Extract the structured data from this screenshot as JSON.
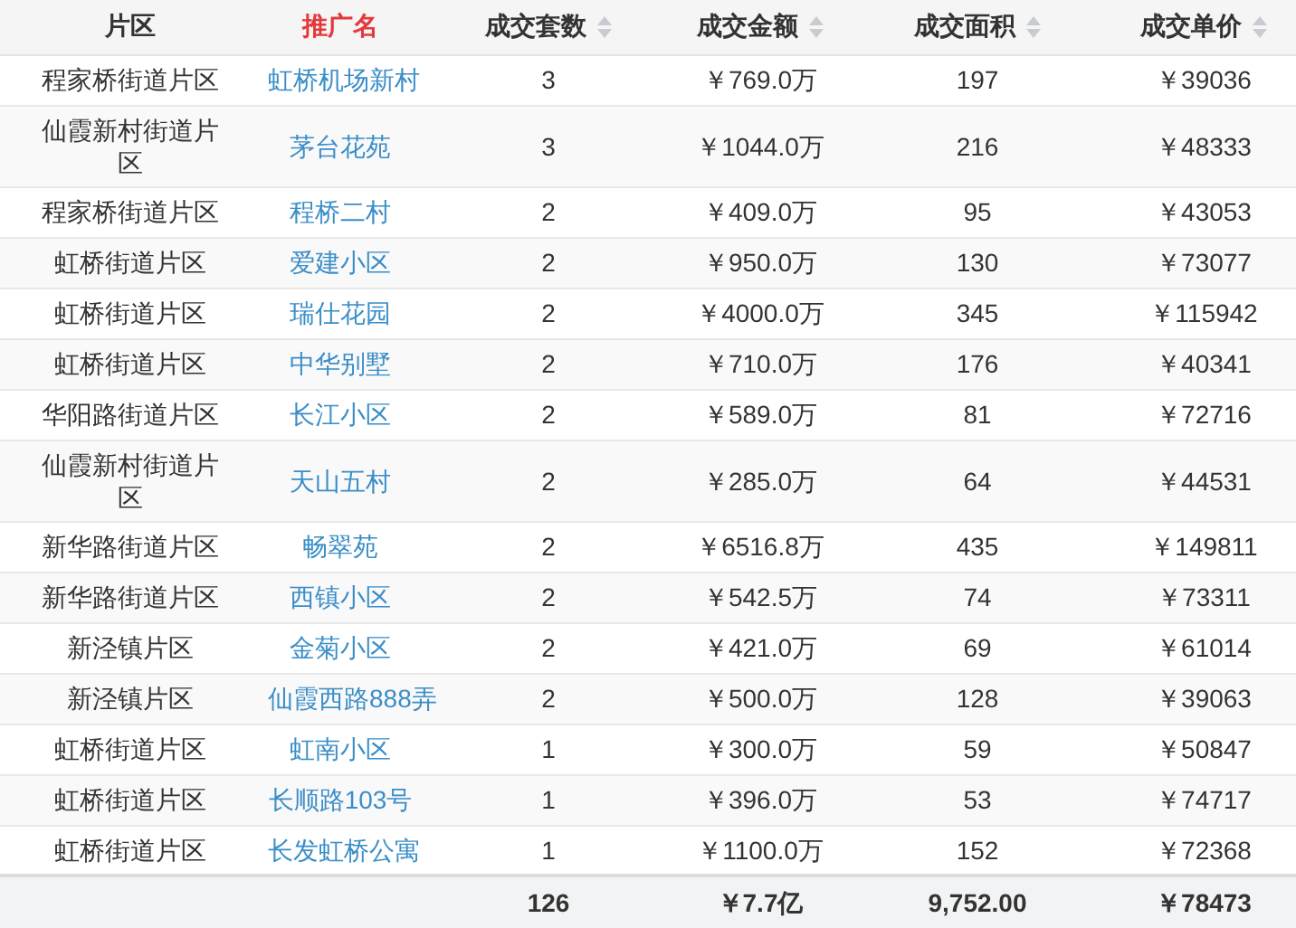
{
  "table": {
    "columns": [
      {
        "label": "片区",
        "sortable": false,
        "highlighted": false
      },
      {
        "label": "推广名",
        "sortable": false,
        "highlighted": true
      },
      {
        "label": "成交套数",
        "sortable": true,
        "highlighted": false
      },
      {
        "label": "成交金额",
        "sortable": true,
        "highlighted": false
      },
      {
        "label": "成交面积",
        "sortable": true,
        "highlighted": false
      },
      {
        "label": "成交单价",
        "sortable": true,
        "highlighted": false
      }
    ],
    "rows": [
      [
        "程家桥街道片区",
        "虹桥机场新村",
        "3",
        "￥769.0万",
        "197",
        "￥39036"
      ],
      [
        "仙霞新村街道片区",
        "茅台花苑",
        "3",
        "￥1044.0万",
        "216",
        "￥48333"
      ],
      [
        "程家桥街道片区",
        "程桥二村",
        "2",
        "￥409.0万",
        "95",
        "￥43053"
      ],
      [
        "虹桥街道片区",
        "爱建小区",
        "2",
        "￥950.0万",
        "130",
        "￥73077"
      ],
      [
        "虹桥街道片区",
        "瑞仕花园",
        "2",
        "￥4000.0万",
        "345",
        "￥115942"
      ],
      [
        "虹桥街道片区",
        "中华别墅",
        "2",
        "￥710.0万",
        "176",
        "￥40341"
      ],
      [
        "华阳路街道片区",
        "长江小区",
        "2",
        "￥589.0万",
        "81",
        "￥72716"
      ],
      [
        "仙霞新村街道片区",
        "天山五村",
        "2",
        "￥285.0万",
        "64",
        "￥44531"
      ],
      [
        "新华路街道片区",
        "畅翠苑",
        "2",
        "￥6516.8万",
        "435",
        "￥149811"
      ],
      [
        "新华路街道片区",
        "西镇小区",
        "2",
        "￥542.5万",
        "74",
        "￥73311"
      ],
      [
        "新泾镇片区",
        "金菊小区",
        "2",
        "￥421.0万",
        "69",
        "￥61014"
      ],
      [
        "新泾镇片区",
        "仙霞西路888弄",
        "2",
        "￥500.0万",
        "128",
        "￥39063"
      ],
      [
        "虹桥街道片区",
        "虹南小区",
        "1",
        "￥300.0万",
        "59",
        "￥50847"
      ],
      [
        "虹桥街道片区",
        "长顺路103号",
        "1",
        "￥396.0万",
        "53",
        "￥74717"
      ],
      [
        "虹桥街道片区",
        "长发虹桥公寓",
        "1",
        "￥1100.0万",
        "152",
        "￥72368"
      ]
    ],
    "totals": {
      "count": "126",
      "amount": "￥7.7亿",
      "area": "9,752.00",
      "unit_price": "￥78473"
    }
  }
}
